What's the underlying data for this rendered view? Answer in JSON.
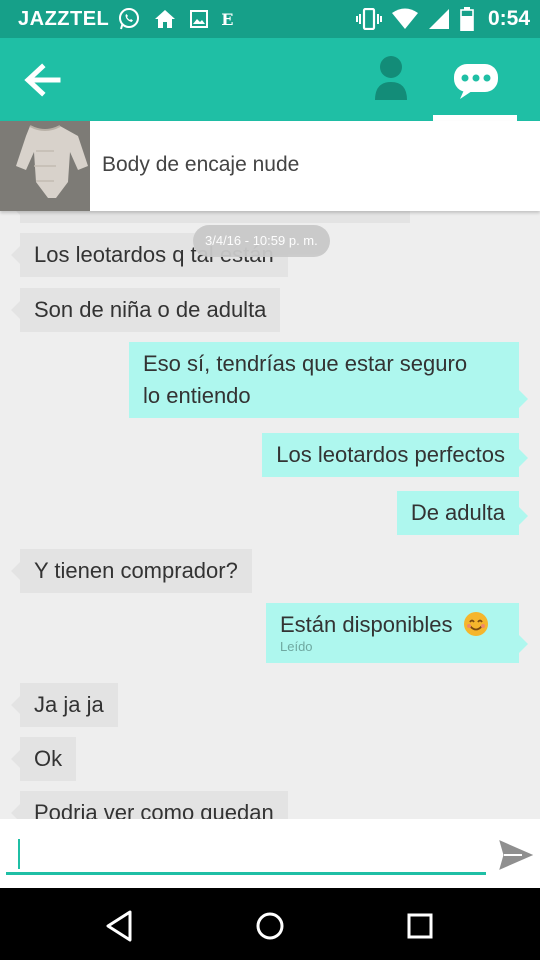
{
  "status_bar": {
    "carrier": "JAZZTEL",
    "e_glyph": "E",
    "time": "0:54",
    "icons": [
      "whatsapp-icon",
      "home-icon",
      "image-icon",
      "e-icon",
      "vibrate-icon",
      "wifi-icon",
      "signal-icon",
      "battery-icon"
    ]
  },
  "app_bar": {
    "icons": [
      "back-arrow-icon",
      "person-icon",
      "chat-bubble-icon"
    ],
    "active_tab": "chat"
  },
  "product": {
    "title": "Body de encaje nude"
  },
  "chat": {
    "date_separator": "3/4/16 - 10:59 p. m.",
    "messages": [
      {
        "dir": "in",
        "text": "Los leotardos q tal están"
      },
      {
        "dir": "in",
        "text": "Son de niña o de adulta"
      },
      {
        "dir": "out",
        "line1": "Eso sí, tendrías que estar seguro",
        "line2": "lo entiendo"
      },
      {
        "dir": "out",
        "text": "Los leotardos perfectos"
      },
      {
        "dir": "out",
        "text": "De adulta"
      },
      {
        "dir": "in",
        "text": "Y tienen comprador?"
      },
      {
        "dir": "out",
        "text": "Están disponibles",
        "emoji": "smiling-face-icon",
        "status": "Leído"
      },
      {
        "dir": "in",
        "text": "Ja ja ja"
      },
      {
        "dir": "in",
        "text": "Ok"
      },
      {
        "dir": "in",
        "text": "Podria ver como quedan"
      }
    ]
  },
  "input": {
    "placeholder": "",
    "value": ""
  },
  "colors": {
    "status_bar": "#16a089",
    "accent": "#1fbfa5",
    "outgoing_bubble": "#aef7ee",
    "incoming_bubble": "#e3e3e3"
  },
  "nav_bar": {
    "icons": [
      "back-triangle-icon",
      "home-circle-icon",
      "recents-square-icon"
    ]
  }
}
